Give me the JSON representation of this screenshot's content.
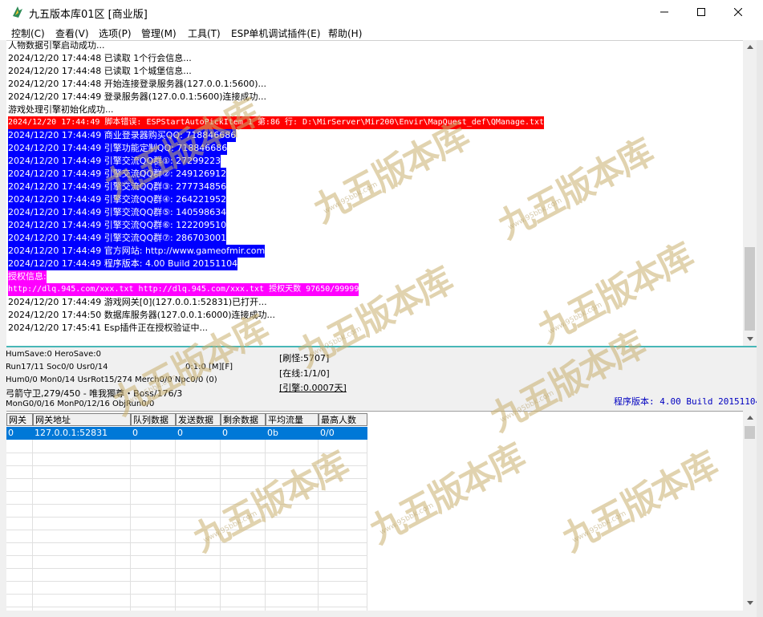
{
  "window": {
    "title": "九五版本库01区 [商业版]"
  },
  "menu": [
    {
      "label": "控制(C)"
    },
    {
      "label": "查看(V)"
    },
    {
      "label": "选项(P)"
    },
    {
      "label": "管理(M)"
    },
    {
      "label": "工具(T)"
    },
    {
      "label": "ESP单机调试插件(E)"
    },
    {
      "label": "帮助(H)"
    }
  ],
  "log": [
    {
      "text": "人物数据引擎启动成功...",
      "style": "normal"
    },
    {
      "text": "2024/12/20 17:44:48 已读取 1个行会信息...",
      "style": "normal"
    },
    {
      "text": "2024/12/20 17:44:48 已读取 1个城堡信息...",
      "style": "normal"
    },
    {
      "text": "2024/12/20 17:44:48 开始连接登录服务器(127.0.0.1:5600)...",
      "style": "normal"
    },
    {
      "text": "2024/12/20 17:44:49 登录服务器(127.0.0.1:5600)连接成功...",
      "style": "normal"
    },
    {
      "text": "游戏处理引擎初始化成功...",
      "style": "normal"
    },
    {
      "text": "2024/12/20 17:44:49 脚本错误: ESPStartAutoPickItem 1 第:86 行: D:\\MirServer\\Mir200\\Envir\\MapQuest_def\\QManage.txt",
      "style": "red"
    },
    {
      "text": "2024/12/20 17:44:49 商业登录器购买QQ: 718846686",
      "style": "blue"
    },
    {
      "text": "2024/12/20 17:44:49 引擎功能定制QQ: 718846686",
      "style": "blue"
    },
    {
      "text": "2024/12/20 17:44:49 引擎交流QQ群①: 27299223",
      "style": "blue"
    },
    {
      "text": "2024/12/20 17:44:49 引擎交流QQ群②: 249126912",
      "style": "blue"
    },
    {
      "text": "2024/12/20 17:44:49 引擎交流QQ群③: 277734856",
      "style": "blue"
    },
    {
      "text": "2024/12/20 17:44:49 引擎交流QQ群④: 264221952",
      "style": "blue"
    },
    {
      "text": "2024/12/20 17:44:49 引擎交流QQ群⑤: 140598634",
      "style": "blue"
    },
    {
      "text": "2024/12/20 17:44:49 引擎交流QQ群⑥: 122209510",
      "style": "blue"
    },
    {
      "text": "2024/12/20 17:44:49 引擎交流QQ群⑦: 286703001",
      "style": "blue"
    },
    {
      "text": "2024/12/20 17:44:49 官方网站: http://www.gameofmir.com",
      "style": "blue"
    },
    {
      "text": "2024/12/20 17:44:49 程序版本: 4.00 Build 20151104",
      "style": "blue"
    },
    {
      "text": "授权信息:",
      "style": "magenta"
    },
    {
      "text": "http://dlq.945.com/xxx.txt http://dlq.945.com/xxx.txt 授权天数 97650/99999",
      "style": "magenta"
    },
    {
      "text": "2024/12/20 17:44:49 游戏网关[0](127.0.0.1:52831)已打开...",
      "style": "normal"
    },
    {
      "text": "2024/12/20 17:44:50 数据库服务器(127.0.0.1:6000)连接成功...",
      "style": "normal"
    },
    {
      "text": "2024/12/20 17:45:41 Esp插件正在授权验证中...",
      "style": "normal"
    }
  ],
  "status": {
    "line1": "HumSave:0 HeroSave:0",
    "line2": "Run17/11 Soc0/0 Usr0/14",
    "line2_mid": "0:1:0 [M][F]",
    "line3": "Hum0/0 Mon0/14 UsrRot15/274 Merch0/0 Npc0/0 (0)",
    "line4": "弓箭守卫,279/450 - 唯我獨尊・Boss/176/3",
    "line5": "MonG0/0/16 MonP0/12/16 ObjRun0/0",
    "refresh": "[刷怪:5707]",
    "online": "[在线:1/1/0]",
    "engine": "[引擎:0.0007天]",
    "version": "程序版本: 4.00 Build 20151104"
  },
  "table": {
    "columns": [
      "网关",
      "网关地址",
      "队列数据",
      "发送数据",
      "剩余数据",
      "平均流量",
      "最高人数"
    ],
    "rows": [
      [
        "0",
        "127.0.0.1:52831",
        "0",
        "0",
        "0",
        "0b",
        "0/0"
      ]
    ]
  },
  "watermark": {
    "text": "九五版本库",
    "sub": "www.95bbk.com"
  },
  "icons": {
    "app": "app-icon",
    "minimize": "minimize-icon",
    "maximize": "maximize-icon",
    "close": "close-icon",
    "scroll_up": "scroll-up-icon",
    "scroll_down": "scroll-down-icon"
  },
  "colors": {
    "error_bg": "#ff0000",
    "info_bg": "#0000ff",
    "license_bg": "#ff00ff",
    "selection": "#0078d7",
    "version_text": "#0000c0"
  }
}
